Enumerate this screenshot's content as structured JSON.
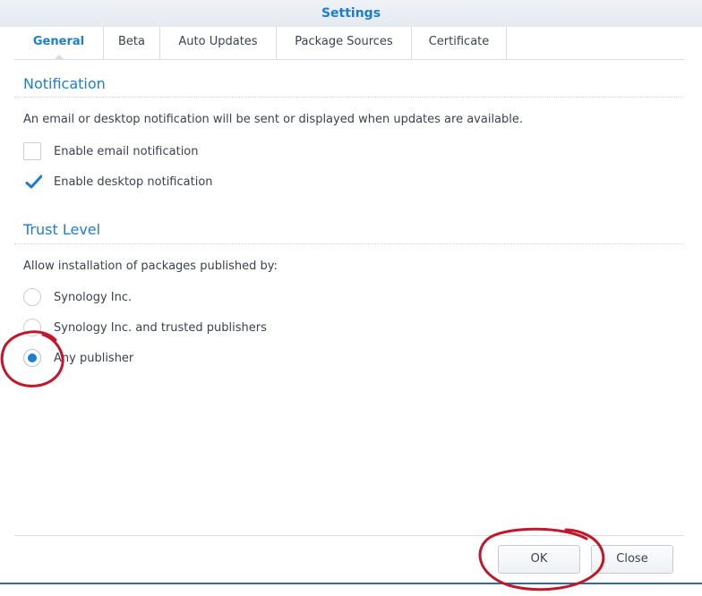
{
  "window": {
    "title": "Settings"
  },
  "tabs": [
    {
      "label": "General",
      "active": true
    },
    {
      "label": "Beta",
      "active": false
    },
    {
      "label": "Auto Updates",
      "active": false
    },
    {
      "label": "Package Sources",
      "active": false
    },
    {
      "label": "Certificate",
      "active": false
    }
  ],
  "notification": {
    "title": "Notification",
    "description": "An email or desktop notification will be sent or displayed when updates are available.",
    "options": [
      {
        "label": "Enable email notification",
        "checked": false
      },
      {
        "label": "Enable desktop notification",
        "checked": true
      }
    ]
  },
  "trust": {
    "title": "Trust Level",
    "description": "Allow installation of packages published by:",
    "options": [
      {
        "label": "Synology Inc.",
        "selected": false
      },
      {
        "label": "Synology Inc. and trusted publishers",
        "selected": false
      },
      {
        "label": "Any publisher",
        "selected": true
      }
    ]
  },
  "buttons": {
    "ok": "OK",
    "close": "Close"
  },
  "colors": {
    "accent": "#1d7dd0",
    "annotation": "#c0182a",
    "bottom_border": "#3566a8"
  }
}
